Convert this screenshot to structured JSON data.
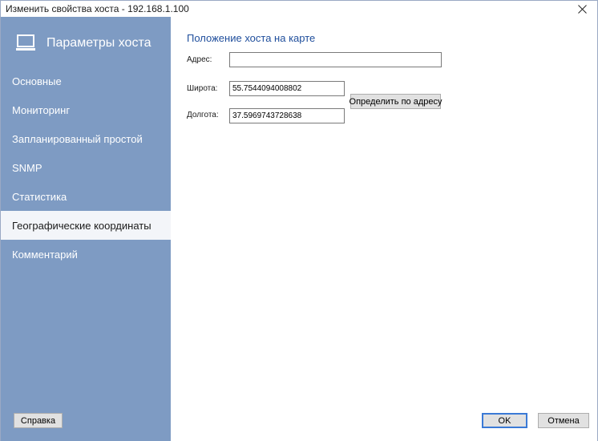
{
  "window": {
    "title": "Изменить свойства хоста - 192.168.1.100",
    "close_symbol": "✕"
  },
  "sidebar": {
    "title": "Параметры хоста",
    "icon": "laptop-icon",
    "items": [
      {
        "label": "Основные",
        "active": false
      },
      {
        "label": "Мониторинг",
        "active": false
      },
      {
        "label": "Запланированный простой",
        "active": false
      },
      {
        "label": "SNMP",
        "active": false
      },
      {
        "label": "Статистика",
        "active": false
      },
      {
        "label": "Географические координаты",
        "active": true
      },
      {
        "label": "Комментарий",
        "active": false
      }
    ],
    "help_label": "Справка"
  },
  "content": {
    "section_title": "Положение хоста на карте",
    "address_label": "Адрес:",
    "address_value": "",
    "latitude_label": "Широта:",
    "latitude_value": "55.7544094008802",
    "longitude_label": "Долгота:",
    "longitude_value": "37.5969743728638",
    "geocode_button": "Определить по адресу"
  },
  "footer": {
    "ok_label": "OK",
    "cancel_label": "Отмена"
  },
  "colors": {
    "sidebar_bg": "#7e9bc3",
    "active_item_bg": "#f3f5f9",
    "section_title": "#1f4e9c",
    "default_button_border": "#3b7ad6"
  }
}
